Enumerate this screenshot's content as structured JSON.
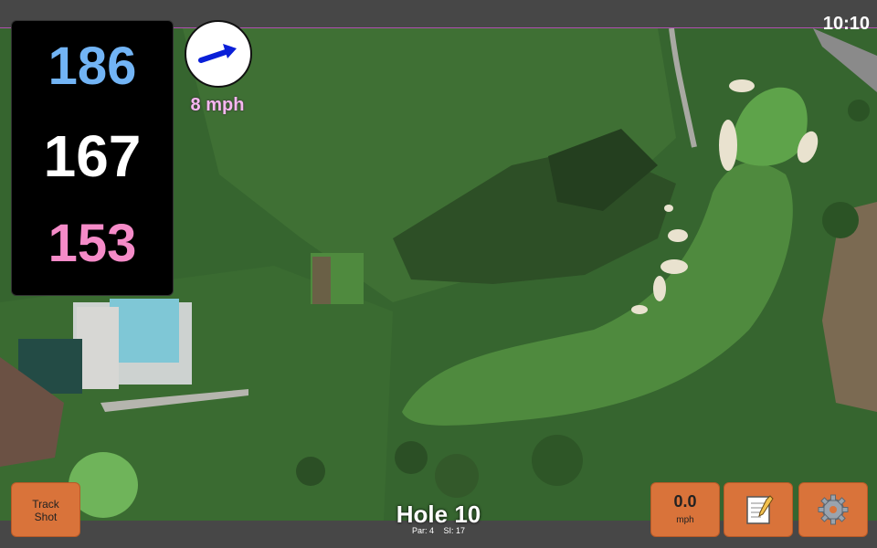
{
  "status": {
    "clock": "10:10"
  },
  "distances": {
    "back": "186",
    "middle": "167",
    "front": "153"
  },
  "wind": {
    "speed": "8 mph",
    "direction_icon": "arrow-right-icon"
  },
  "hole": {
    "title": "Hole 10",
    "par": "Par: 4",
    "si": "SI: 17"
  },
  "buttons": {
    "track_line1": "Track",
    "track_line2": "Shot",
    "speed_value": "0.0",
    "speed_unit": "mph",
    "notes_icon": "notepad-icon",
    "settings_icon": "gear-icon"
  },
  "colors": {
    "back": "#72b4f5",
    "middle": "#ffffff",
    "front": "#f58bc8",
    "button": "#d9733a",
    "wind_text": "#f6b7f0"
  }
}
